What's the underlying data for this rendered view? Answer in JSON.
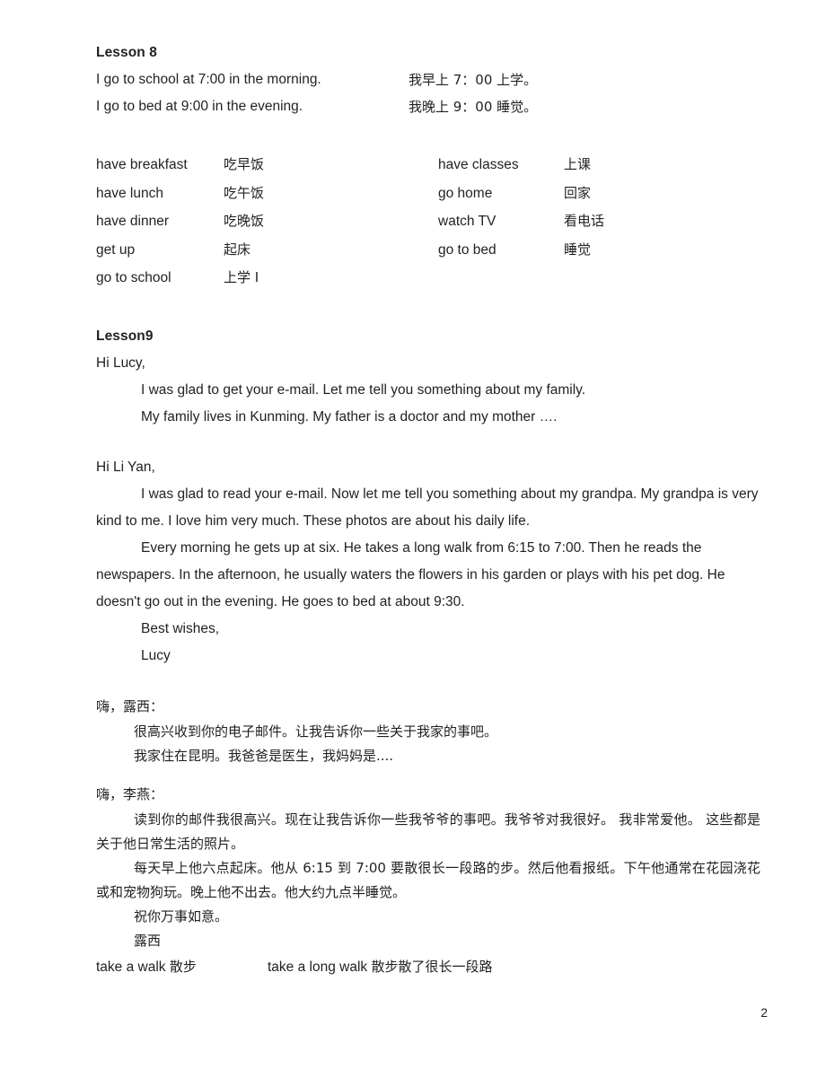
{
  "document": {
    "page_number": "2",
    "background_color": "#ffffff",
    "text_color": "#231f20"
  },
  "lesson8": {
    "heading": "Lesson 8",
    "sentences": [
      {
        "en": "I go to school at 7:00 in the morning.",
        "cn": "我早上 7：00 上学。"
      },
      {
        "en": "I go to bed at 9:00 in the evening.",
        "cn": "我晚上 9：00 睡觉。"
      }
    ],
    "vocabulary_left": [
      {
        "en": "have breakfast",
        "cn": "吃早饭"
      },
      {
        "en": "have lunch",
        "cn": "吃午饭"
      },
      {
        "en": "have dinner",
        "cn": "吃晚饭"
      },
      {
        "en": "get up",
        "cn": "起床"
      },
      {
        "en": "go to school",
        "cn": "上学 I"
      }
    ],
    "vocabulary_right": [
      {
        "en": "have classes",
        "cn": "上课"
      },
      {
        "en": "go home",
        "cn": "回家"
      },
      {
        "en": "watch TV",
        "cn": "看电话"
      },
      {
        "en": "go to bed",
        "cn": "睡觉"
      }
    ]
  },
  "lesson9": {
    "heading": "Lesson9",
    "letter1": {
      "salutation": "Hi Lucy,",
      "paragraphs": [
        "I was glad to get your e-mail. Let me tell you something about my family.",
        "My family lives in Kunming. My father is a doctor and my mother …."
      ]
    },
    "letter2": {
      "salutation": "Hi Li Yan,",
      "paragraph1": "I was glad to read your e-mail. Now let me tell you something about my grandpa. My grandpa is very kind to me. I love him very much. These photos are about his daily life.",
      "paragraph2": "Every morning he gets up at six. He takes a long walk from 6:15 to 7:00. Then he reads the newspapers. In the afternoon, he usually waters the flowers in his garden or plays with his pet dog. He doesn't go out in the evening. He goes to bed at about 9:30.",
      "closing": "Best wishes,",
      "signature": "Lucy"
    },
    "letter1_cn": {
      "salutation": "嗨，露西：",
      "paragraphs": [
        "很高兴收到你的电子邮件。让我告诉你一些关于我家的事吧。",
        "我家住在昆明。我爸爸是医生，我妈妈是...."
      ]
    },
    "letter2_cn": {
      "salutation": "嗨，李燕：",
      "paragraph1": "读到你的邮件我很高兴。现在让我告诉你一些我爷爷的事吧。我爷爷对我很好。 我非常爱他。 这些都是关于他日常生活的照片。",
      "paragraph2": "每天早上他六点起床。他从 6:15 到 7:00 要散很长一段路的步。然后他看报纸。下午他通常在花园浇花或和宠物狗玩。晚上他不出去。他大约九点半睡觉。",
      "closing": "祝你万事如意。",
      "signature": "露西"
    },
    "phrases": [
      {
        "en": "take a walk ",
        "cn": "散步"
      },
      {
        "en": "take a long walk ",
        "cn": "散步散了很长一段路"
      }
    ]
  }
}
